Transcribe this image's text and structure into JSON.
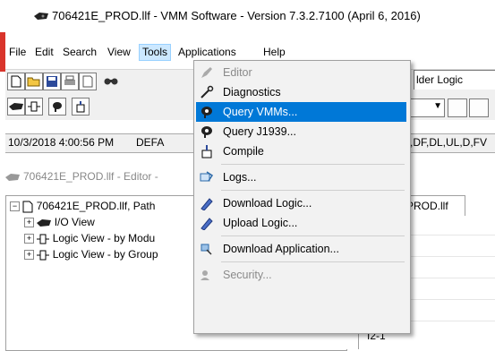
{
  "window": {
    "title": "706421E_PROD.llf - VMM Software - Version 7.3.2.7100 (April 6, 2016)"
  },
  "menubar": {
    "items": [
      "File",
      "Edit",
      "Search",
      "View",
      "Tools",
      "Applications",
      "Help"
    ]
  },
  "toolbar": {
    "tab_label": "lder Logic"
  },
  "status": {
    "datetime": "10/3/2018 4:00:56 PM",
    "field2": "DEFA",
    "field3": ",DF,DL,UL,D,FV"
  },
  "editor": {
    "title": "706421E_PROD.llf - Editor -",
    "tree": {
      "root": "706421E_PROD.llf, Path",
      "children": [
        "I/O View",
        "Logic View - by Modu",
        "Logic View - by Group"
      ]
    },
    "right_tab": "PROD.llf",
    "right_item": "I2-1"
  },
  "tools_menu": {
    "items": [
      {
        "label": "Editor",
        "icon": "editor-icon",
        "disabled": true
      },
      {
        "label": "Diagnostics",
        "icon": "wrench-icon",
        "disabled": false
      },
      {
        "label": "Query VMMs...",
        "icon": "query-vmm-icon",
        "disabled": false,
        "highlighted": true
      },
      {
        "label": "Query J1939...",
        "icon": "query-j1939-icon",
        "disabled": false
      },
      {
        "label": "Compile",
        "icon": "compile-icon",
        "disabled": false
      },
      {
        "label": "Logs...",
        "icon": "logs-icon",
        "disabled": false
      },
      {
        "label": "Download Logic...",
        "icon": "download-logic-icon",
        "disabled": false
      },
      {
        "label": "Upload Logic...",
        "icon": "upload-logic-icon",
        "disabled": false
      },
      {
        "label": "Download Application...",
        "icon": "download-app-icon",
        "disabled": false
      },
      {
        "label": "Security...",
        "icon": "security-icon",
        "disabled": true
      }
    ]
  },
  "colors": {
    "highlight": "#0078d7",
    "menu_bg": "#f2f2f2",
    "active_menu": "#cce8ff",
    "window_edge": "#d9342b"
  }
}
